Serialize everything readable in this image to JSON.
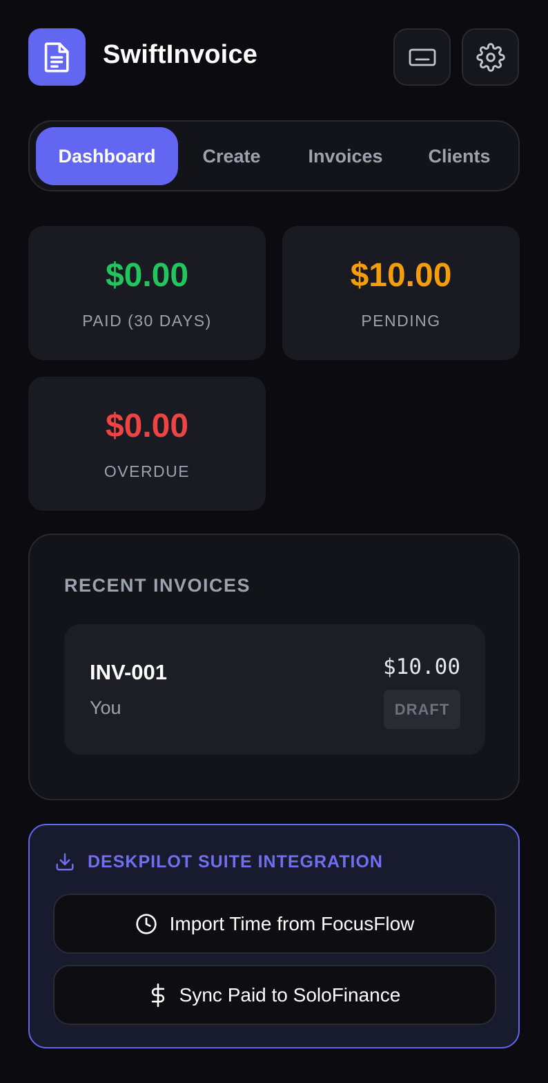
{
  "header": {
    "app_title": "SwiftInvoice",
    "logo_icon": "document-icon",
    "buttons": [
      {
        "icon": "keyboard-icon"
      },
      {
        "icon": "gear-icon"
      }
    ]
  },
  "tabs": [
    {
      "label": "Dashboard",
      "active": true
    },
    {
      "label": "Create",
      "active": false
    },
    {
      "label": "Invoices",
      "active": false
    },
    {
      "label": "Clients",
      "active": false
    }
  ],
  "stats": {
    "paid": {
      "amount": "$0.00",
      "label": "PAID (30 DAYS)",
      "color": "#22c55e"
    },
    "pending": {
      "amount": "$10.00",
      "label": "PENDING",
      "color": "#f59e0b"
    },
    "overdue": {
      "amount": "$0.00",
      "label": "OVERDUE",
      "color": "#ef4444"
    }
  },
  "recent": {
    "title": "RECENT INVOICES",
    "invoices": [
      {
        "number": "INV-001",
        "client": "You",
        "amount": "$10.00",
        "status": "DRAFT"
      }
    ]
  },
  "integration": {
    "title": "DESKPILOT SUITE INTEGRATION",
    "icon": "download-icon",
    "buttons": [
      {
        "label": "Import Time from FocusFlow",
        "icon": "clock-icon"
      },
      {
        "label": "Sync Paid to SoloFinance",
        "icon": "dollar-icon"
      }
    ]
  },
  "colors": {
    "accent": "#6366f1",
    "background": "#0b0b10"
  }
}
